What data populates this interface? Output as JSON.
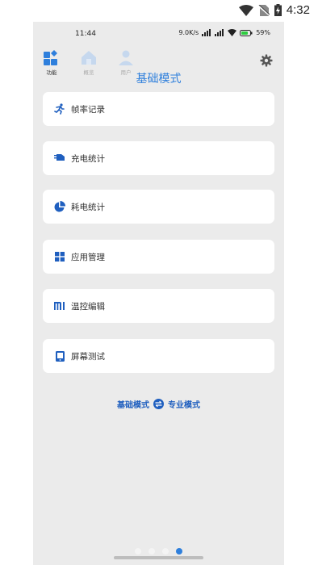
{
  "system_status": {
    "time": "4:32"
  },
  "inner_status": {
    "time": "11:44",
    "speed": "9.0K/s",
    "battery": "59"
  },
  "top_nav": [
    {
      "label": "功能",
      "icon": "grid-feature-icon",
      "active": true
    },
    {
      "label": "概览",
      "icon": "house-icon",
      "active": false
    },
    {
      "label": "用户",
      "icon": "user-icon",
      "active": false
    }
  ],
  "page_title": "基础模式",
  "menu": [
    {
      "label": "帧率记录",
      "icon": "running-icon"
    },
    {
      "label": "充电统计",
      "icon": "charger-icon"
    },
    {
      "label": "耗电统计",
      "icon": "pie-icon"
    },
    {
      "label": "应用管理",
      "icon": "apps-grid-icon"
    },
    {
      "label": "温控编辑",
      "icon": "mi-logo-icon"
    },
    {
      "label": "屏幕测试",
      "icon": "phone-screen-icon"
    }
  ],
  "mode_switch": {
    "left": "基础模式",
    "right": "专业模式"
  },
  "colors": {
    "accent": "#2e7fdc",
    "background": "#ebebeb",
    "card": "#ffffff"
  }
}
